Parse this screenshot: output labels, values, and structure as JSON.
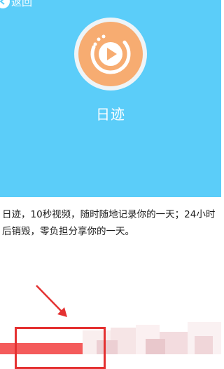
{
  "nav": {
    "back_label": "返回"
  },
  "app": {
    "name": "日迹",
    "description": "日迹，10秒视频，随时随地记录你的一天；24小时后销毁，零负担分享你的一天。"
  },
  "colors": {
    "header_bg": "#5bcdf9",
    "logo_orange": "#f7ac71",
    "bottom_bar": "#f45b5b",
    "annotation_red": "#e43131"
  },
  "icons": [
    "back-arrow-icon",
    "video-play-icon",
    "annotation-arrow-icon"
  ]
}
